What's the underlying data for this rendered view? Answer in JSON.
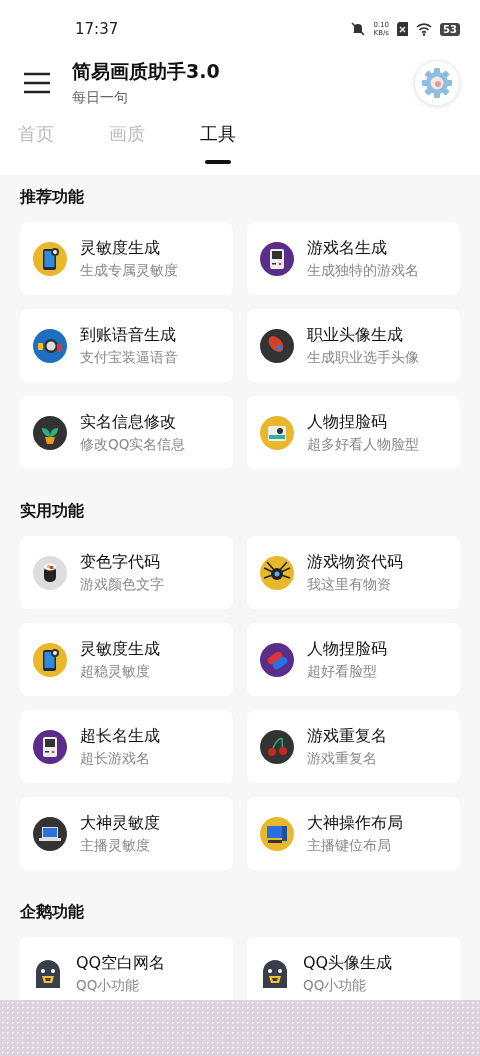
{
  "status_bar": {
    "time": "17:37",
    "speed": "0.10",
    "speed_unit": "KB/s",
    "battery": "53"
  },
  "header": {
    "title": "简易画质助手3.0",
    "subtitle": "每日一句"
  },
  "tabs": [
    {
      "label": "首页",
      "selected": false
    },
    {
      "label": "画质",
      "selected": false
    },
    {
      "label": "工具",
      "selected": true
    }
  ],
  "sections": [
    {
      "title": "推荐功能",
      "items": [
        {
          "kind": "phone",
          "title": "灵敏度生成",
          "subtitle": "生成专属灵敏度"
        },
        {
          "kind": "gameboy",
          "title": "游戏名生成",
          "subtitle": "生成独特的游戏名"
        },
        {
          "kind": "speaker",
          "title": "到账语音生成",
          "subtitle": "支付宝装逼语音"
        },
        {
          "kind": "rocket",
          "title": "职业头像生成",
          "subtitle": "生成职业选手头像"
        },
        {
          "kind": "plant",
          "title": "实名信息修改",
          "subtitle": "修改QQ实名信息"
        },
        {
          "kind": "camera",
          "title": "人物捏脸码",
          "subtitle": "超多好看人物脸型"
        }
      ]
    },
    {
      "title": "实用功能",
      "items": [
        {
          "kind": "sushi",
          "title": "变色字代码",
          "subtitle": "游戏颜色文字"
        },
        {
          "kind": "spider",
          "title": "游戏物资代码",
          "subtitle": "我这里有物资"
        },
        {
          "kind": "phone",
          "title": "灵敏度生成",
          "subtitle": "超稳灵敏度"
        },
        {
          "kind": "pills",
          "title": "人物捏脸码",
          "subtitle": "超好看脸型"
        },
        {
          "kind": "gameboy",
          "title": "超长名生成",
          "subtitle": "超长游戏名"
        },
        {
          "kind": "cherries",
          "title": "游戏重复名",
          "subtitle": "游戏重复名"
        },
        {
          "kind": "laptop",
          "title": "大神灵敏度",
          "subtitle": "主播灵敏度"
        },
        {
          "kind": "computer",
          "title": "大神操作布局",
          "subtitle": "主播键位布局"
        }
      ]
    },
    {
      "title": "企鹅功能",
      "items": [
        {
          "kind": "penguin",
          "title": "QQ空白网名",
          "subtitle": "QQ小功能"
        },
        {
          "kind": "penguin",
          "title": "QQ头像生成",
          "subtitle": "QQ小功能"
        }
      ]
    }
  ]
}
